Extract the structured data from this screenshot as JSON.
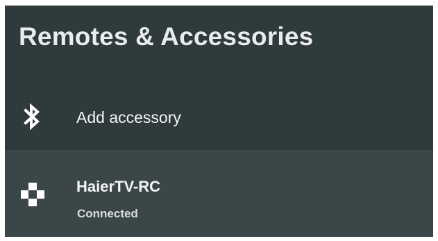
{
  "page": {
    "title": "Remotes & Accessories"
  },
  "items": [
    {
      "icon": "bluetooth-icon",
      "label": "Add accessory"
    },
    {
      "icon": "gamepad-icon",
      "label": "HaierTV-RC",
      "status": "Connected"
    }
  ],
  "colors": {
    "background": "#2f3a3d",
    "selected_row": "#3b4649",
    "text": "#ffffff"
  }
}
